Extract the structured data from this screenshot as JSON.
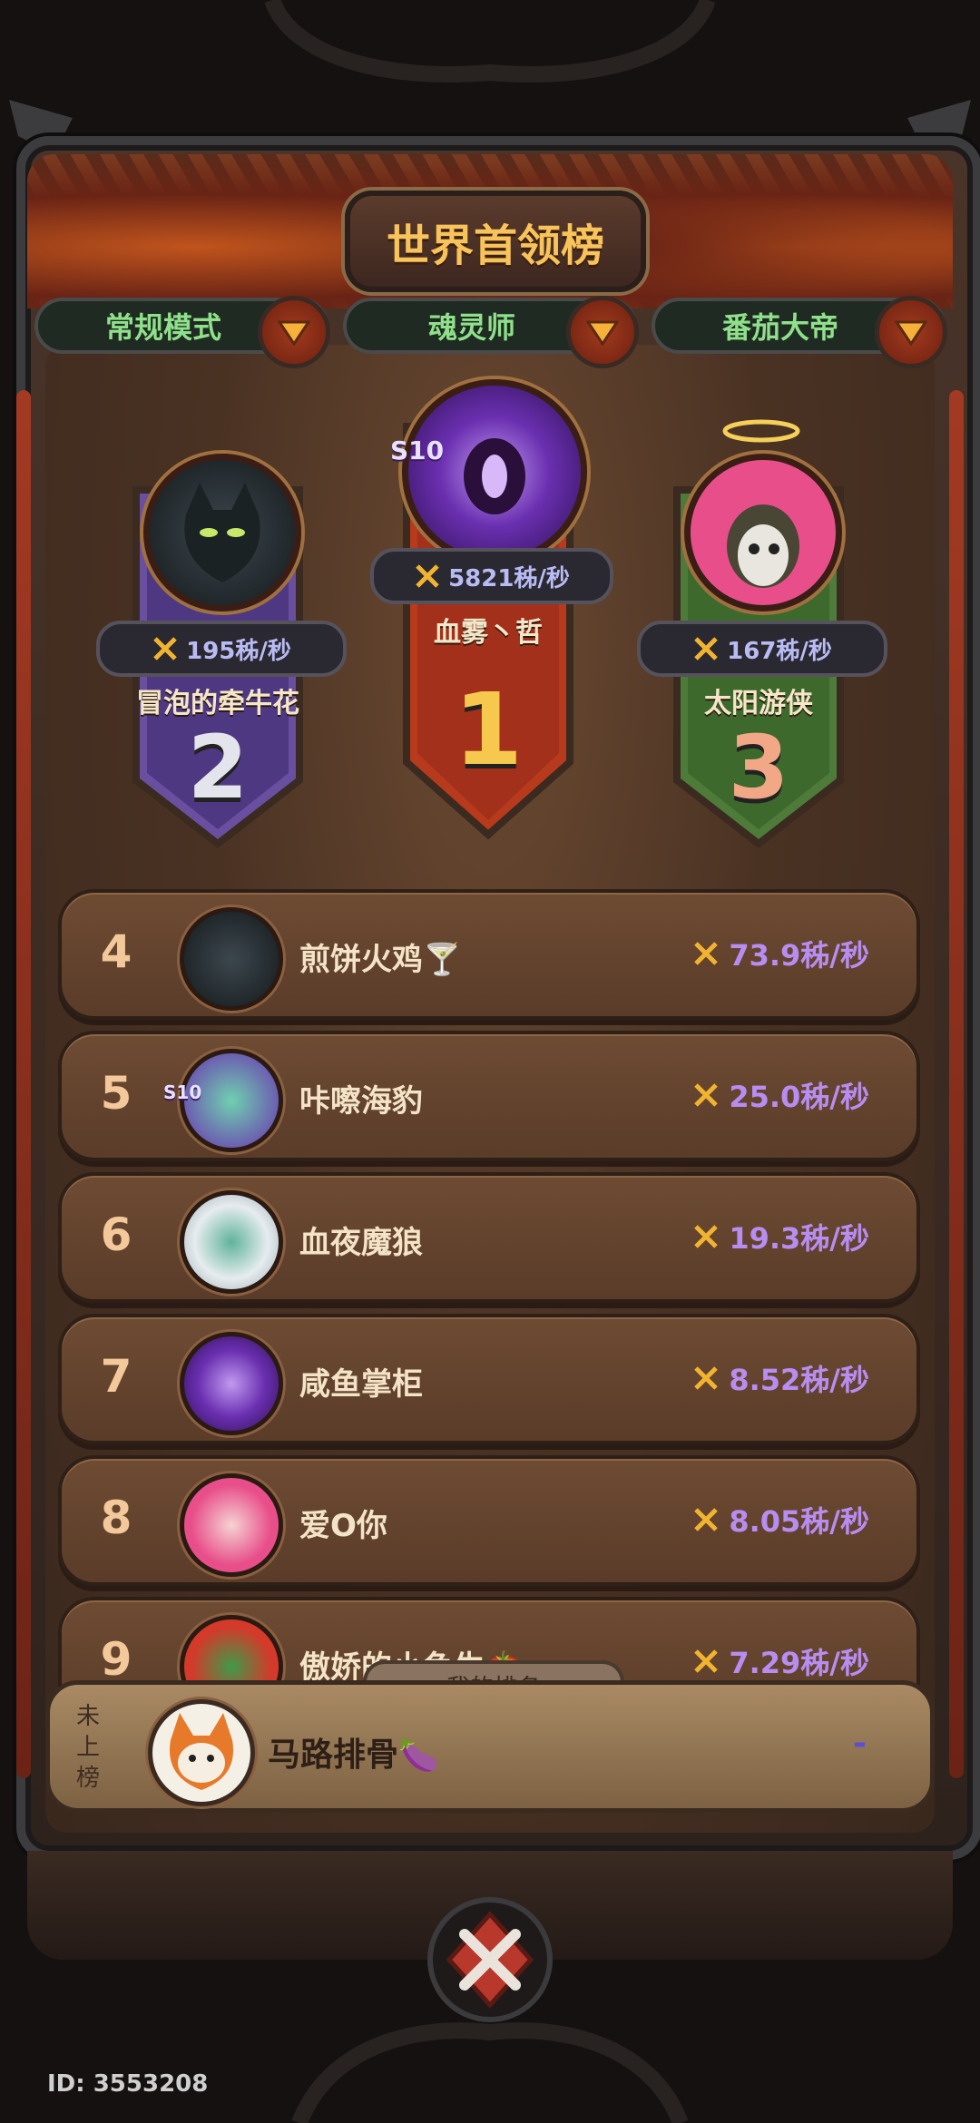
{
  "title": "世界首领榜",
  "tabs": [
    {
      "label": "常规模式"
    },
    {
      "label": "魂灵师"
    },
    {
      "label": "番茄大帝"
    }
  ],
  "podium": [
    {
      "rank": "1",
      "name": "血雾丶哲",
      "score": "5821秭/秒",
      "badge": "S10"
    },
    {
      "rank": "2",
      "name": "冒泡的牵牛花",
      "score": "195秭/秒"
    },
    {
      "rank": "3",
      "name": "太阳游侠",
      "score": "167秭/秒"
    }
  ],
  "rows": [
    {
      "rank": "4",
      "name": "煎饼火鸡🍸",
      "score": "73.9秭/秒"
    },
    {
      "rank": "5",
      "name": "咔嚓海豹",
      "score": "25.0秭/秒",
      "badge": "S10"
    },
    {
      "rank": "6",
      "name": "血夜魔狼",
      "score": "19.3秭/秒"
    },
    {
      "rank": "7",
      "name": "咸鱼掌柜",
      "score": "8.52秭/秒"
    },
    {
      "rank": "8",
      "name": "爱O你",
      "score": "8.05秭/秒"
    },
    {
      "rank": "9",
      "name": "傲娇的小鱼生🍅",
      "score": "7.29秭/秒"
    }
  ],
  "my_rank": {
    "tab_label": "我的排名",
    "status": "未上榜",
    "name": "马路排骨🍆",
    "score": "-"
  },
  "user_id": "ID: 3553208",
  "colors": {
    "gold": "#f8c35a",
    "score_purple": "#b88df2",
    "tab_green": "#8fe08a"
  }
}
